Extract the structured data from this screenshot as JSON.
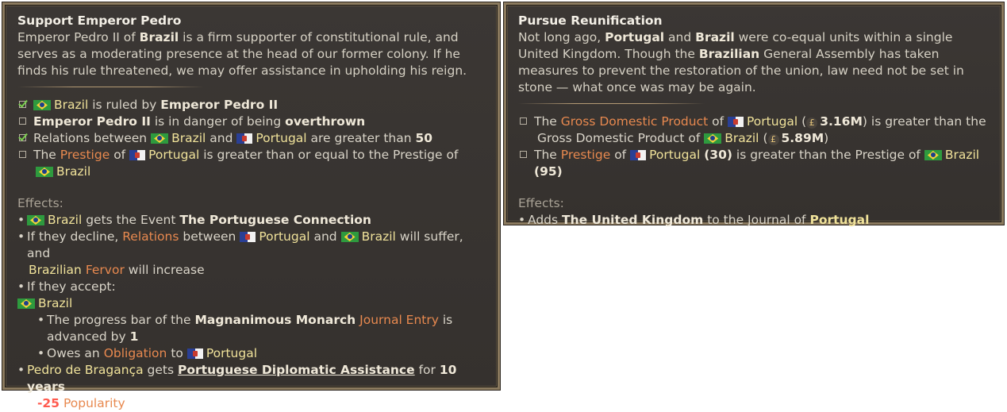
{
  "left": {
    "title": "Support Emperor Pedro",
    "desc": {
      "p1": "Emperor Pedro II of ",
      "brazil": "Brazil",
      "p2": " is a firm supporter of constitutional rule, and serves as a moderating presence at the head of our former colony. If he finds his rule threatened, we may offer assistance in upholding his reign."
    },
    "conditions": {
      "c1": {
        "checked": true,
        "country": "Brazil",
        "mid": "is ruled by",
        "bold": "Emperor Pedro II"
      },
      "c2": {
        "checked": false,
        "bold1": "Emperor Pedro II",
        "mid": "is in danger of being",
        "bold2": "overthrown"
      },
      "c3": {
        "checked": true,
        "pre": "Relations between",
        "country1": "Brazil",
        "and": "and",
        "country2": "Portugal",
        "post": "are greater than",
        "value": "50"
      },
      "c4": {
        "checked": false,
        "the": "The",
        "prestige": "Prestige",
        "of": "of",
        "country1": "Portugal",
        "post": "is greater than or equal to the Prestige of",
        "country2": "Brazil"
      }
    },
    "effects": {
      "label": "Effects:",
      "e1": {
        "country": "Brazil",
        "mid": "gets the Event",
        "bold": "The Portuguese Connection"
      },
      "e2": {
        "pre": "If they decline,",
        "relations": "Relations",
        "between": "between",
        "country1": "Portugal",
        "and": "and",
        "country2": "Brazil",
        "post": "will suffer, and",
        "adj": "Brazilian",
        "fervor": "Fervor",
        "post2": "will increase"
      },
      "e3": {
        "text": "If they accept:"
      },
      "e3_country": "Brazil",
      "e4": {
        "pre": "The progress bar of the",
        "bold": "Magnanimous Monarch",
        "je": "Journal Entry",
        "post": "is advanced by",
        "value": "1"
      },
      "e5": {
        "pre": "Owes an",
        "obligation": "Obligation",
        "to": "to",
        "country": "Portugal"
      },
      "e6": {
        "name": "Pedro de Bragança",
        "mid": "gets",
        "bold": "Portuguese Diplomatic Assistance",
        "for": "for",
        "years": "10 years"
      },
      "e7": {
        "value": "-25",
        "label": "Popularity"
      }
    }
  },
  "right": {
    "title": "Pursue Reunification",
    "desc": {
      "p1": "Not long ago, ",
      "portugal": "Portugal",
      "and": " and ",
      "brazil": "Brazil",
      "p2": " were co-equal units within a single United Kingdom. Though the ",
      "brazilian": "Brazilian",
      "p3": " General Assembly has taken measures to prevent the restoration of the union, law need not be set in stone — what once was may be again."
    },
    "conditions": {
      "c1": {
        "checked": false,
        "the": "The",
        "gdp": "Gross Domestic Product",
        "of": "of",
        "country1": "Portugal",
        "open": "(",
        "val1": "3.16M",
        "close": ")",
        "post": "is greater than the",
        "line2": "Gross Domestic Product of",
        "country2": "Brazil",
        "open2": "(",
        "val2": "5.89M",
        "close2": ")"
      },
      "c2": {
        "checked": false,
        "the": "The",
        "prestige": "Prestige",
        "of": "of",
        "country1": "Portugal",
        "val1": "(30)",
        "post": "is greater than the Prestige of",
        "country2": "Brazil",
        "val2": "(95)"
      }
    },
    "effects": {
      "label": "Effects:",
      "e1": {
        "pre": "Adds",
        "bold": "The United Kingdom",
        "mid": "to the Journal of",
        "country": "Portugal"
      }
    }
  },
  "icons": {
    "brazil_flag": "brazil-flag-icon",
    "portugal_flag": "portugal-flag-icon",
    "money": "pound-icon",
    "checkbox": "checkbox-icon"
  },
  "colors": {
    "panel_bg": "#38342f",
    "border": "#8b7a5e",
    "country": "#f0e29a",
    "keyword": "#e8894f",
    "negative": "#ff5a4e",
    "check": "#7bd14f"
  }
}
